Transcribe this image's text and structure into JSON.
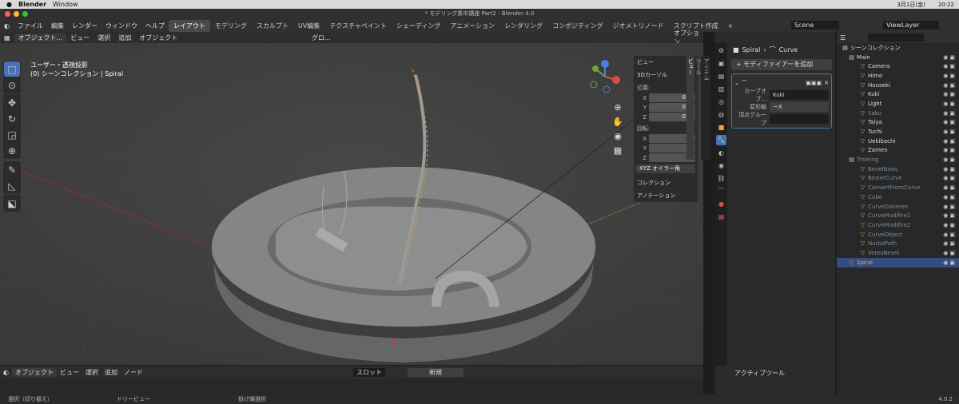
{
  "mac": {
    "app": "Blender",
    "menu": "Window",
    "date": "3月1日(金)",
    "time": "20:22"
  },
  "title": "* モデリング集中講座 Part2 - Blender 4.0",
  "menus": [
    "ファイル",
    "編集",
    "レンダー",
    "ウィンドウ",
    "ヘルプ"
  ],
  "workspaces": [
    "レイアウト",
    "モデリング",
    "スカルプト",
    "UV編集",
    "テクスチャペイント",
    "シェーディング",
    "アニメーション",
    "レンダリング",
    "コンポジティング",
    "ジオメトリノード",
    "スクリプト作成"
  ],
  "scene": "Scene",
  "viewlayer": "ViewLayer",
  "viewport_header": {
    "mode": "オブジェクト...",
    "view": "ビュー",
    "select": "選択",
    "add": "追加",
    "object": "オブジェクト",
    "transform": "グロ...",
    "options": "オプション"
  },
  "overlay": {
    "line1": "ユーザー・透視投影",
    "line2": "(0) シーンコレクション | Spiral"
  },
  "npanel": {
    "view": "ビュー",
    "cursor": "3Dカーソル",
    "location": "位置:",
    "x": "X",
    "y": "Y",
    "z": "Z",
    "lx": "0 m",
    "ly": "0 m",
    "lz": "0 m",
    "rotation": "回転:",
    "rx": "0°",
    "ry": "0°",
    "rz": "0°",
    "mode": "XYZ オイラー角",
    "collection": "コレクション",
    "annotation": "アノテーション"
  },
  "sidetabs": [
    "アイテム",
    "ツール",
    "ビュー"
  ],
  "props": {
    "object": "Spiral",
    "data": "Curve",
    "add_modifier": "モディファイアーを追加",
    "curve_label": "カーブオブ...",
    "curve_value": "Kuki",
    "deform_label": "変形軸",
    "deform_value": "ーX",
    "vgroup_label": "頂点グループ"
  },
  "outliner": {
    "header": "シーンコレクション",
    "rows": [
      {
        "name": "Main",
        "icon": "☑"
      },
      {
        "name": "Camera",
        "icon": "▣"
      },
      {
        "name": "Himo",
        "icon": "▽"
      },
      {
        "name": "Houseki",
        "icon": "▽"
      },
      {
        "name": "Kuki",
        "icon": "▽"
      },
      {
        "name": "Light",
        "icon": "◉"
      },
      {
        "name": "Saku",
        "icon": "▽"
      },
      {
        "name": "Taiya",
        "icon": "▽"
      },
      {
        "name": "Tuchi",
        "icon": "▽"
      },
      {
        "name": "Uekibachi",
        "icon": "▽"
      },
      {
        "name": "Zamen",
        "icon": "▽"
      },
      {
        "name": "Training",
        "icon": "☑"
      },
      {
        "name": "BevelBasic",
        "icon": "▽"
      },
      {
        "name": "BezierCurve",
        "icon": "▽"
      },
      {
        "name": "ConvertFromCurve",
        "icon": "▽"
      },
      {
        "name": "Cube",
        "icon": "▽"
      },
      {
        "name": "CurveDanmen",
        "icon": "▽"
      },
      {
        "name": "CurveModifire1",
        "icon": "▽"
      },
      {
        "name": "CurveModifire2",
        "icon": "▽"
      },
      {
        "name": "CurveObject",
        "icon": "▽"
      },
      {
        "name": "NurbsPath",
        "icon": "▽"
      },
      {
        "name": "VetexBevel",
        "icon": "▽"
      },
      {
        "name": "Spiral",
        "icon": "▽"
      }
    ]
  },
  "bottom": {
    "mode": "オブジェクト",
    "view": "ビュー",
    "select": "選択",
    "add": "追加",
    "node": "ノード",
    "slot": "スロット",
    "new": "新規"
  },
  "active_tool": "アクティブツール",
  "status": {
    "select": "選択（切り替え）",
    "dolly": "ドリービュー",
    "lasso": "投げ縄選択",
    "version": "4.0.2"
  }
}
